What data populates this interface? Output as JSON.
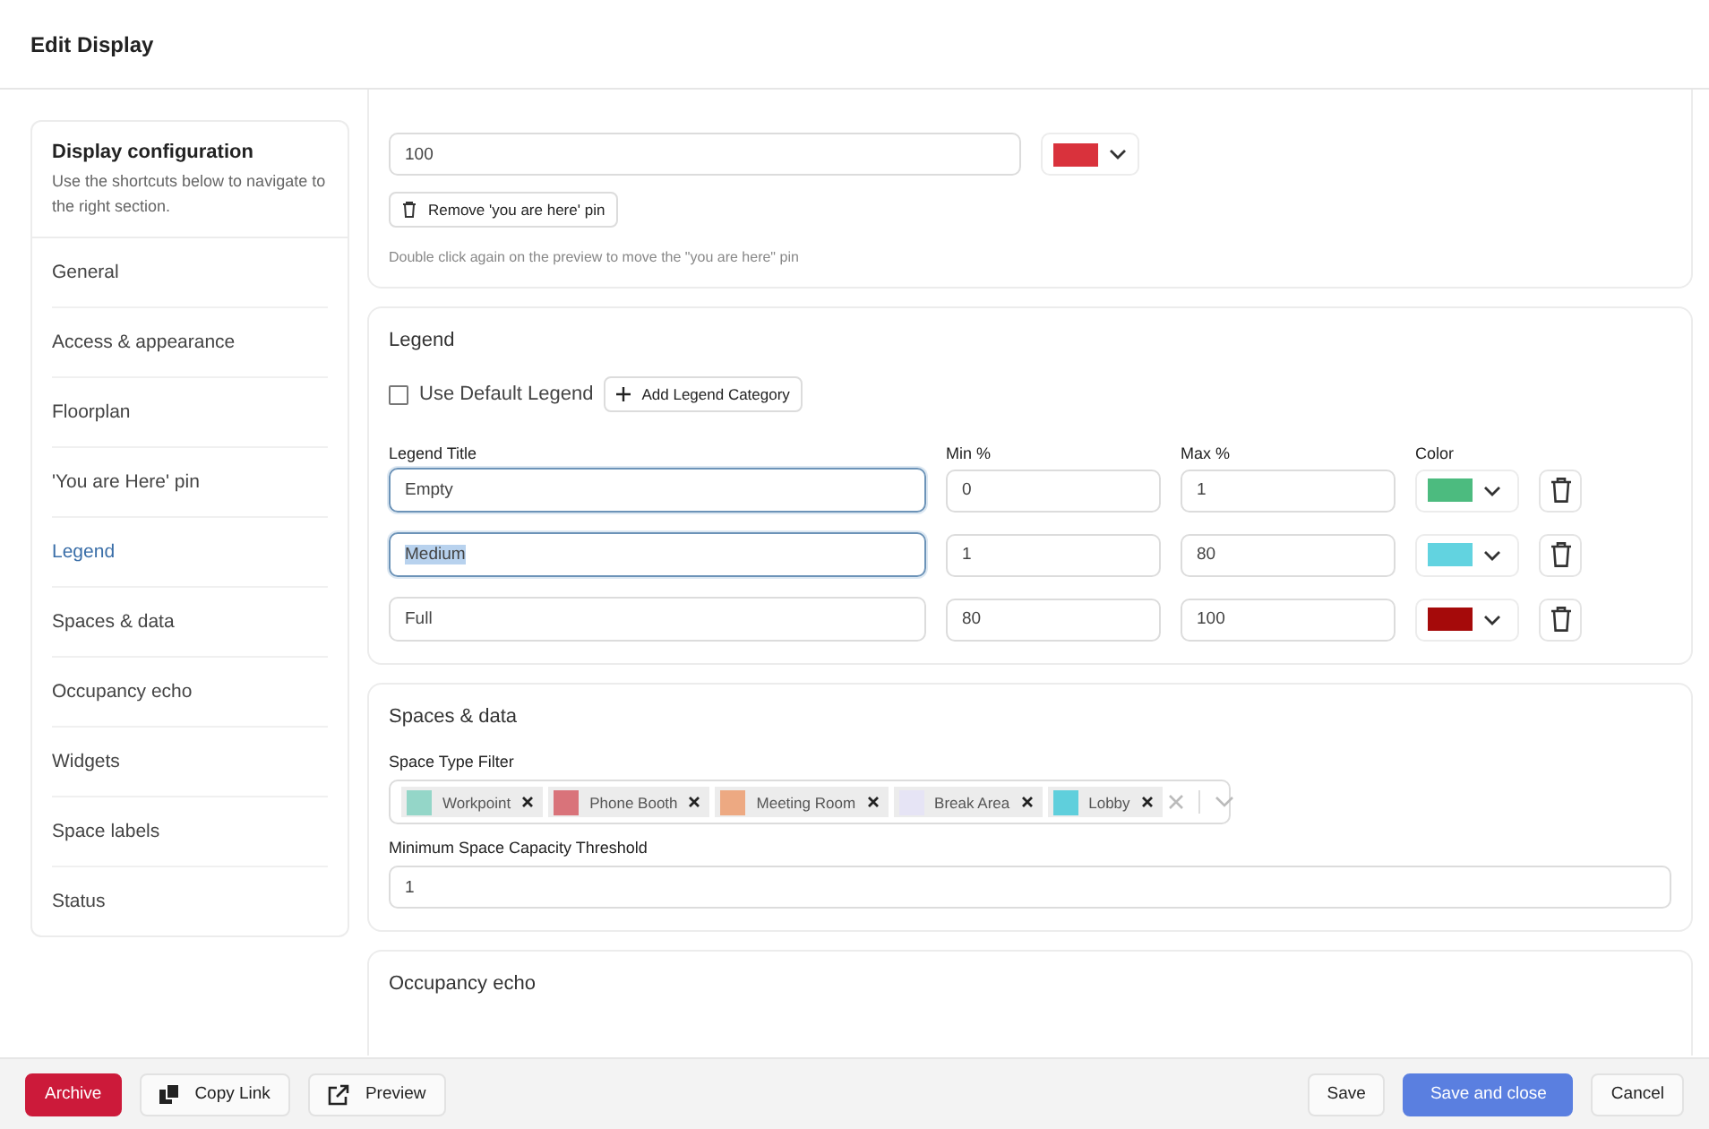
{
  "window": {
    "title": "Edit Display"
  },
  "sidebar": {
    "title": "Display configuration",
    "subtitle": "Use the shortcuts below to navigate to the right section.",
    "items": [
      {
        "label": "General",
        "selected": false
      },
      {
        "label": "Access & appearance",
        "selected": false
      },
      {
        "label": "Floorplan",
        "selected": false
      },
      {
        "label": "'You are Here' pin",
        "selected": false
      },
      {
        "label": "Legend",
        "selected": true
      },
      {
        "label": "Spaces & data",
        "selected": false
      },
      {
        "label": "Occupancy echo",
        "selected": false
      },
      {
        "label": "Widgets",
        "selected": false
      },
      {
        "label": "Space labels",
        "selected": false
      },
      {
        "label": "Status",
        "selected": false
      }
    ]
  },
  "pin": {
    "size_value": "100",
    "color": "#d9323c",
    "remove_button": "Remove 'you are here' pin",
    "hint": "Double click again on the preview to move the \"you are here\" pin"
  },
  "legend": {
    "title": "Legend",
    "use_default": {
      "label": "Use Default Legend",
      "checked": false
    },
    "add_button": "Add Legend Category",
    "columns": [
      "Legend Title",
      "Min %",
      "Max %",
      "Color"
    ],
    "rows": [
      {
        "title": "Empty",
        "min": "0",
        "max": "1",
        "color": "#4cbb7f",
        "focused": true,
        "text_selected": false
      },
      {
        "title": "Medium",
        "min": "1",
        "max": "80",
        "color": "#62d3e0",
        "focused": true,
        "text_selected": true
      },
      {
        "title": "Full",
        "min": "80",
        "max": "100",
        "color": "#a50a0a",
        "focused": false,
        "text_selected": false
      }
    ]
  },
  "spaces": {
    "title": "Spaces & data",
    "filter_label": "Space Type Filter",
    "tags": [
      {
        "label": "Workpoint",
        "color": "#94d6c8"
      },
      {
        "label": "Phone Booth",
        "color": "#d9737a"
      },
      {
        "label": "Meeting Room",
        "color": "#eda982"
      },
      {
        "label": "Break Area",
        "color": "#e6e4f5"
      },
      {
        "label": "Lobby",
        "color": "#5fcfdc"
      }
    ],
    "capacity_label": "Minimum Space Capacity Threshold",
    "capacity_value": "1"
  },
  "occupancy": {
    "title": "Occupancy echo"
  },
  "footer": {
    "archive": "Archive",
    "copy_link": "Copy Link",
    "preview": "Preview",
    "save": "Save",
    "save_close": "Save and close",
    "cancel": "Cancel"
  }
}
